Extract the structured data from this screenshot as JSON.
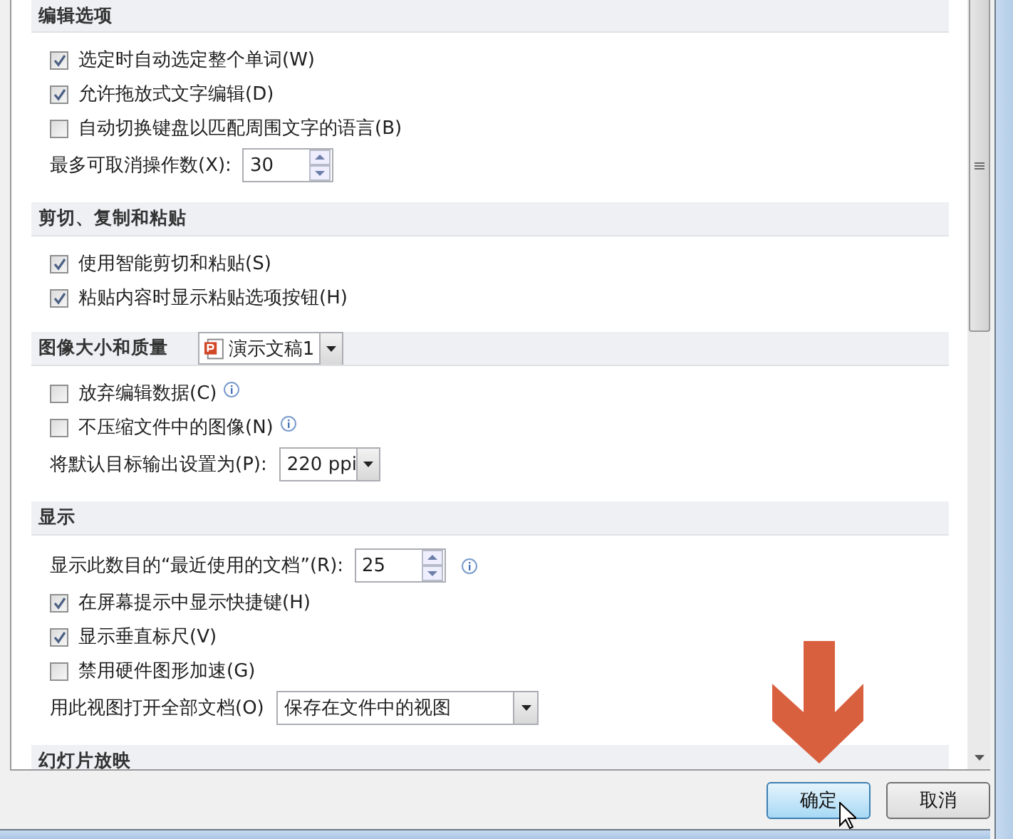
{
  "sections": [
    {
      "title": "编辑选项",
      "items": [
        {
          "kind": "checkbox",
          "label": "选定时自动选定整个单词(W)",
          "checked": true
        },
        {
          "kind": "checkbox",
          "label": "允许拖放式文字编辑(D)",
          "checked": true
        },
        {
          "kind": "checkbox",
          "label": "自动切换键盘以匹配周围文字的语言(B)",
          "checked": false
        },
        {
          "kind": "spin",
          "label": "最多可取消操作数(X):",
          "value": "30"
        }
      ]
    },
    {
      "title": "剪切、复制和粘贴",
      "items": [
        {
          "kind": "checkbox",
          "label": "使用智能剪切和粘贴(S)",
          "checked": true
        },
        {
          "kind": "checkbox",
          "label": "粘贴内容时显示粘贴选项按钮(H)",
          "checked": true
        }
      ]
    },
    {
      "title": "图像大小和质量",
      "document": "演示文稿1",
      "items": [
        {
          "kind": "checkbox",
          "label": "放弃编辑数据(C)",
          "checked": false,
          "info": true
        },
        {
          "kind": "checkbox",
          "label": "不压缩文件中的图像(N)",
          "checked": false,
          "info": true
        },
        {
          "kind": "dropdown",
          "label": "将默认目标输出设置为(P):",
          "value": "220 ppi"
        }
      ]
    },
    {
      "title": "显示",
      "items": [
        {
          "kind": "spin",
          "label": "显示此数目的“最近使用的文档”(R):",
          "value": "25",
          "info": true
        },
        {
          "kind": "checkbox",
          "label": "在屏幕提示中显示快捷键(H)",
          "checked": true
        },
        {
          "kind": "checkbox",
          "label": "显示垂直标尺(V)",
          "checked": true
        },
        {
          "kind": "checkbox",
          "label": "禁用硬件图形加速(G)",
          "checked": false
        },
        {
          "kind": "wide-dropdown",
          "label": "用此视图打开全部文档(O)",
          "value": "保存在文件中的视图"
        }
      ]
    },
    {
      "title": "幻灯片放映"
    }
  ],
  "buttons": [
    {
      "label": "确定",
      "kind": "default"
    },
    {
      "label": "取消",
      "kind": "normal"
    }
  ]
}
